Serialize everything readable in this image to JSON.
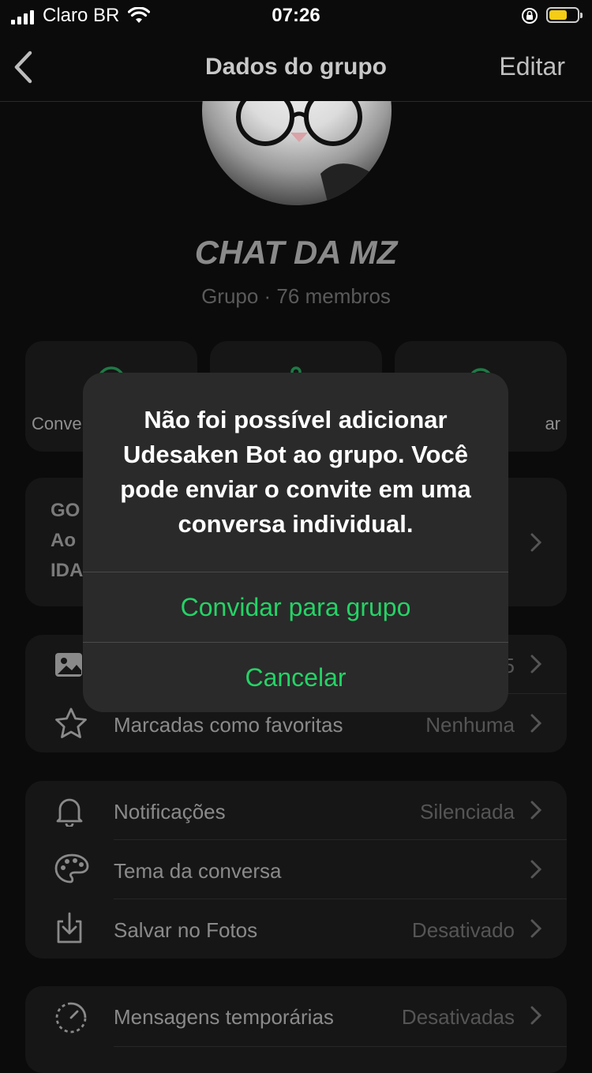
{
  "status_bar": {
    "carrier": "Claro BR",
    "time": "07:26",
    "battery_percent": 65
  },
  "nav": {
    "title": "Dados do grupo",
    "edit_label": "Editar"
  },
  "group": {
    "name": "CHAT DA MZ",
    "meta": "Grupo · 76 membros"
  },
  "action_buttons": [
    {
      "label": "Conve",
      "icon": "chat-icon"
    },
    {
      "label": "",
      "icon": "audio-call-icon"
    },
    {
      "label": "ar",
      "icon": "search-icon"
    }
  ],
  "description": {
    "lines": [
      "GO",
      "Ao",
      "IDA"
    ]
  },
  "media_section": {
    "rows": [
      {
        "label": "",
        "value": "5",
        "icon": "photo-icon"
      },
      {
        "label": "Marcadas como favoritas",
        "value": "Nenhuma",
        "icon": "star-icon"
      }
    ]
  },
  "settings_section": {
    "rows": [
      {
        "label": "Notificações",
        "value": "Silenciada",
        "icon": "bell-icon"
      },
      {
        "label": "Tema da conversa",
        "value": "",
        "icon": "palette-icon"
      },
      {
        "label": "Salvar no Fotos",
        "value": "Desativado",
        "icon": "save-download-icon"
      }
    ]
  },
  "privacy_section": {
    "rows": [
      {
        "label": "Mensagens temporárias",
        "value": "Desativadas",
        "icon": "timer-icon"
      }
    ]
  },
  "alert": {
    "message": "Não foi possível adicionar Udesaken Bot ao grupo. Você pode enviar o convite em uma conversa individual.",
    "primary_action": "Convidar para grupo",
    "cancel_action": "Cancelar"
  },
  "colors": {
    "accent": "#25d366",
    "background": "#0b0b0b",
    "card": "#161616",
    "alert": "#2a2a2a",
    "battery": "#f5cc16"
  }
}
